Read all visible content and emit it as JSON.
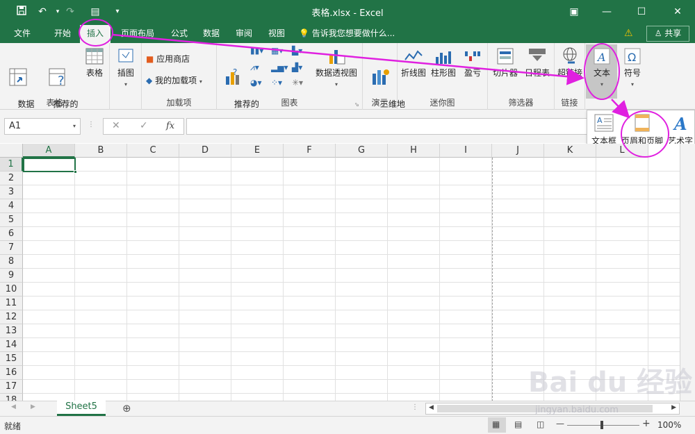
{
  "titlebar": {
    "title": "表格.xlsx - Excel",
    "save_icon": "save-icon",
    "undo_glyph": "↶",
    "redo_glyph": "↷",
    "form_glyph": "▤",
    "customize_glyph": "▾",
    "ribbon_display_glyph": "▣",
    "minimize_glyph": "—",
    "maximize_glyph": "☐",
    "close_glyph": "✕"
  },
  "tabs": [
    {
      "label": "文件",
      "name": "tab-file"
    },
    {
      "label": "开始",
      "name": "tab-home"
    },
    {
      "label": "插入",
      "name": "tab-insert",
      "active": true
    },
    {
      "label": "页面布局",
      "name": "tab-page-layout"
    },
    {
      "label": "公式",
      "name": "tab-formulas"
    },
    {
      "label": "数据",
      "name": "tab-data"
    },
    {
      "label": "审阅",
      "name": "tab-review"
    },
    {
      "label": "视图",
      "name": "tab-view"
    }
  ],
  "tell_me": "告诉我您想要做什么...",
  "share_label": "共享",
  "ribbon": {
    "tables": {
      "label": "表格",
      "pivot": "数据\n透视表",
      "recommended_pivot": "推荐的\n数据透视表",
      "table": "表格"
    },
    "illustrations": {
      "label": "插图"
    },
    "addins": {
      "label": "加载项",
      "store": "应用商店",
      "my_addins": "我的加载项"
    },
    "charts": {
      "label": "图表",
      "recommended": "推荐的\n图表",
      "pivot_chart": "数据透视图"
    },
    "tours": {
      "label": "演示",
      "map3d": "三维地\n图"
    },
    "sparklines": {
      "label": "迷你图",
      "line": "折线图",
      "column": "柱形图",
      "winloss": "盈亏"
    },
    "filters": {
      "label": "筛选器",
      "slicer": "切片器",
      "timeline": "日程表"
    },
    "links": {
      "label": "链接",
      "hyperlink": "超链接"
    },
    "text": {
      "label": "文本"
    },
    "symbols": {
      "label": "符号"
    }
  },
  "text_panel": {
    "textbox": "文本框",
    "header_footer": "页眉和页脚",
    "wordart": "艺术字",
    "group_label": "文本"
  },
  "formula_bar": {
    "name_box": "A1",
    "cancel": "✕",
    "enter": "✓",
    "fx": "fx",
    "formula": ""
  },
  "columns": [
    "A",
    "B",
    "C",
    "D",
    "E",
    "F",
    "G",
    "H",
    "I",
    "J",
    "K",
    "L"
  ],
  "rows": [
    "1",
    "2",
    "3",
    "4",
    "5",
    "6",
    "7",
    "8",
    "9",
    "10",
    "11",
    "12",
    "13",
    "14",
    "15",
    "16",
    "17",
    "18"
  ],
  "sheet_tab": "Sheet5",
  "add_sheet": "⊕",
  "status": {
    "ready": "就绪",
    "zoom": "100%",
    "zoom_minus": "—",
    "zoom_plus": "+"
  },
  "watermark": {
    "brand": "Bai du 经验",
    "url": "jingyan.baidu.com"
  },
  "accent": "#217346",
  "annotation_color": "#e020e0"
}
